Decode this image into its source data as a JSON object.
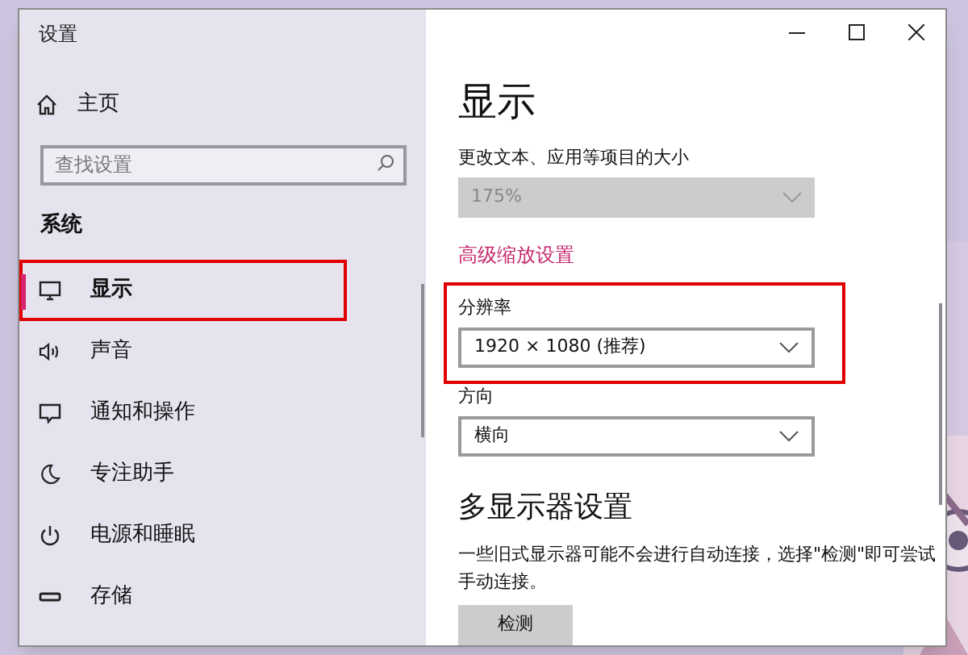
{
  "window": {
    "title": "设置"
  },
  "sidebar": {
    "home": "主页",
    "search": {
      "placeholder": "查找设置"
    },
    "section": "系统",
    "items": [
      {
        "label": "显示",
        "selected": true,
        "highlighted": true
      },
      {
        "label": "声音",
        "selected": false,
        "highlighted": false
      },
      {
        "label": "通知和操作",
        "selected": false,
        "highlighted": false
      },
      {
        "label": "专注助手",
        "selected": false,
        "highlighted": false
      },
      {
        "label": "电源和睡眠",
        "selected": false,
        "highlighted": false
      },
      {
        "label": "存储",
        "selected": false,
        "highlighted": false
      }
    ]
  },
  "content": {
    "heading": "显示",
    "fields": [
      {
        "label": "更改文本、应用等项目的大小",
        "value": "175%",
        "disabled": true,
        "highlighted": false
      },
      {
        "kind": "link",
        "label": "高级缩放设置"
      },
      {
        "label": "分辨率",
        "value": "1920 × 1080 (推荐)",
        "disabled": false,
        "highlighted": true
      },
      {
        "label": "方向",
        "value": "横向",
        "disabled": false,
        "highlighted": false
      }
    ],
    "multi_heading": "多显示器设置",
    "paragraph": "一些旧式显示器可能不会进行自动连接，选择\"检测\"即可尝试手动连接。",
    "button": "检测"
  }
}
